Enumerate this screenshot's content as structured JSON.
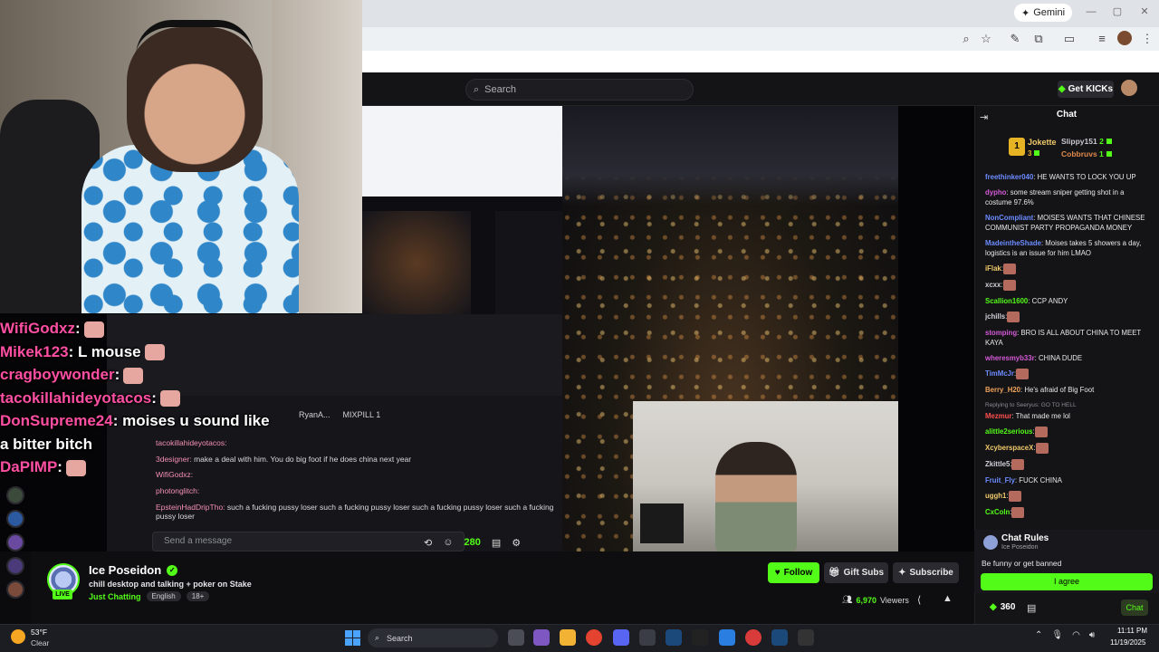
{
  "browser": {
    "gemini_label": "Gemini"
  },
  "kick_header": {
    "search_placeholder": "Search",
    "get_kicks_label": "Get KICKs"
  },
  "overlay_chat": [
    {
      "user": "WifiGodxz",
      "text": ":"
    },
    {
      "user": "Mikek123",
      "text": ": L mouse"
    },
    {
      "user": "cragboywonder",
      "text": ":"
    },
    {
      "user": "tacokillahideyotacos",
      "text": ":"
    },
    {
      "user": "DonSupreme24",
      "text": ": moises u sound like a bitter bitch"
    },
    {
      "user": "DaPIMP",
      "text": ":"
    }
  ],
  "inner_stream": {
    "tabs": [
      "RyanA...",
      "MIXPILL 1"
    ],
    "chat": [
      {
        "user": "tacokillahideyotacos:",
        "text": ""
      },
      {
        "user": "3designer:",
        "text": "make a deal with him. You do big foot if he does china next year"
      },
      {
        "user": "WifiGodxz:",
        "text": ""
      },
      {
        "user": "photonglitch:",
        "text": ""
      },
      {
        "user": "EpsteinHadDripTho:",
        "text": "such a fucking pussy loser such a fucking pussy loser such a fucking pussy loser such a fucking pussy loser"
      }
    ],
    "send_placeholder": "Send a message",
    "kicks": "280"
  },
  "channel": {
    "name": "Ice Poseidon",
    "title": "chill desktop and talking + poker on Stake",
    "category": "Just Chatting",
    "tags": [
      "English",
      "18+"
    ],
    "live": "LIVE",
    "follow": "Follow",
    "gift_subs": "Gift Subs",
    "subscribe": "Subscribe",
    "viewers": "6,970",
    "viewers_label": "Viewers"
  },
  "chat": {
    "title": "Chat",
    "leaderboard": {
      "rank1": "1",
      "first": "Jokette",
      "first_count": "3",
      "second": "Slippy151",
      "second_count": "2",
      "third": "Cobbruvs",
      "third_count": "1"
    },
    "messages": [
      {
        "user": "freethinker040",
        "text": ": HE WANTS TO LOCK YOU UP",
        "color": "#6c8cff"
      },
      {
        "user": "dypho",
        "text": ": some stream sniper getting shot in a costume 97.6%",
        "color": "#d35ad6"
      },
      {
        "user": "NonCompliant",
        "text": ": MOISES WANTS THAT CHINESE COMMUNIST PARTY PROPAGANDA MONEY",
        "color": "#6c8cff"
      },
      {
        "user": "MadeintheShade",
        "text": ": Moises takes 5 showers a day, logistics is an issue for him LMAO",
        "color": "#6c8cff"
      },
      {
        "user": "iFlak",
        "text": ":",
        "color": "#f0c96a"
      },
      {
        "user": "xcxx",
        "text": ":",
        "color": "#cfcfd6"
      },
      {
        "user": "Scallion1600",
        "text": ": CCP ANDY",
        "color": "#53fc18"
      },
      {
        "user": "jchills",
        "text": ":",
        "color": "#cfcfd6"
      },
      {
        "user": "stomping",
        "text": ": BRO IS ALL ABOUT CHINA TO MEET KAYA",
        "color": "#d35ad6"
      },
      {
        "user": "wheresmyb33r",
        "text": ": CHINA DUDE",
        "color": "#d35ad6"
      },
      {
        "user": "TimMcJr",
        "text": ":",
        "color": "#6c8cff"
      },
      {
        "user": "Berry_H20",
        "text": ": He's afraid of Big Foot",
        "color": "#f0a35a"
      },
      {
        "user": "Mezmur",
        "text": ": That made me lol",
        "color": "#ff4f4f",
        "reply": "Replying to Seeryus: GO TO HELL"
      },
      {
        "user": "alittle2serious",
        "text": ":",
        "color": "#53fc18"
      },
      {
        "user": "XcyberspaceX",
        "text": ":",
        "color": "#f0c96a"
      },
      {
        "user": "Zkittle5",
        "text": ":",
        "color": "#cfcfd6"
      },
      {
        "user": "Fruit_Fly",
        "text": ": FUCK CHINA",
        "color": "#6c8cff"
      },
      {
        "user": "uggh1",
        "text": ":",
        "color": "#f0c96a"
      },
      {
        "user": "CxColn",
        "text": ":",
        "color": "#53fc18"
      }
    ],
    "rules": {
      "title": "Chat Rules",
      "subtitle": "Ice Poseidon",
      "text": "Be funny or get banned",
      "agree": "I agree"
    },
    "kicks": "360",
    "send": "Chat"
  },
  "taskbar": {
    "weather_temp": "53°F",
    "weather_desc": "Clear",
    "weather_badge": "8",
    "search": "Search",
    "time": "11:11 PM",
    "date": "11/19/2025"
  },
  "colors": {
    "kick_green": "#53fc18",
    "overlay_name": "#ff4fa3"
  }
}
